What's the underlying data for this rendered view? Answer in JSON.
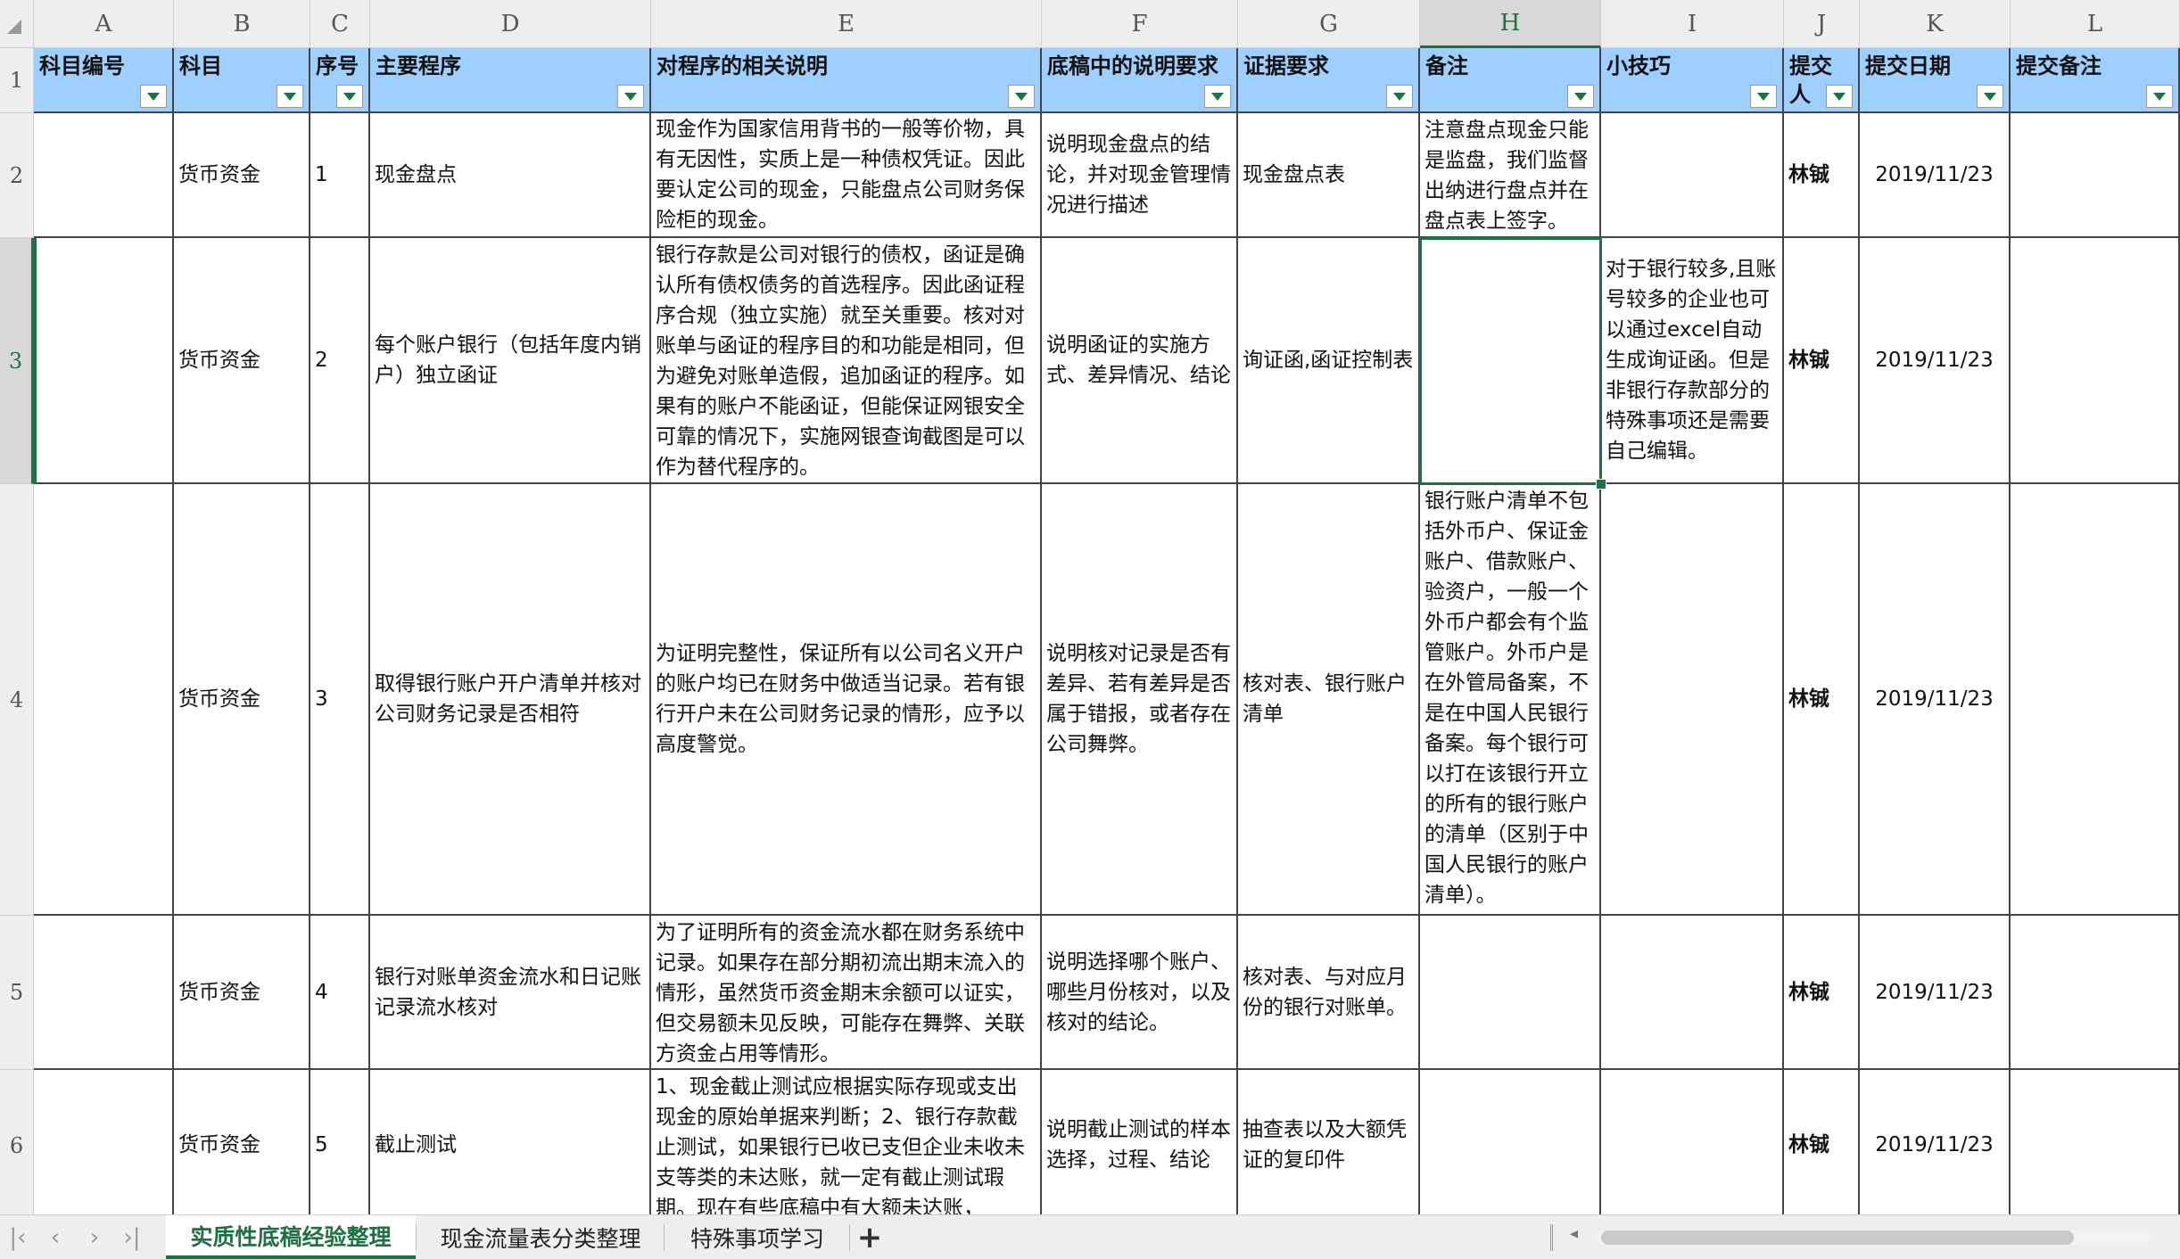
{
  "columns": [
    "A",
    "B",
    "C",
    "D",
    "E",
    "F",
    "G",
    "H",
    "I",
    "J",
    "K",
    "L"
  ],
  "selected_column": "H",
  "selected_row": "3",
  "header_row": {
    "number": "1",
    "cells": [
      "科目编号",
      "科目",
      "序号",
      "主要程序",
      "对程序的相关说明",
      "底稿中的说明要求",
      "证据要求",
      "备注",
      "小技巧",
      "提交人",
      "提交日期",
      "提交备注"
    ]
  },
  "rows": [
    {
      "number": "2",
      "cells": [
        "",
        "货币资金",
        "1",
        " 现金盘点",
        "现金作为国家信用背书的一般等价物，具有无因性，实质上是一种债权凭证。因此要认定公司的现金，只能盘点公司财务保险柜的现金。",
        "说明现金盘点的结论，并对现金管理情况进行描述",
        "现金盘点表",
        "注意盘点现金只能是监盘，我们监督出纳进行盘点并在盘点表上签字。",
        "",
        "林铖",
        "2019/11/23",
        ""
      ]
    },
    {
      "number": "3",
      "cells": [
        "",
        "货币资金",
        "2",
        "每个账户银行（包括年度内销户）独立函证",
        "银行存款是公司对银行的债权，函证是确认所有债权债务的首选程序。因此函证程序合规（独立实施）就至关重要。核对对账单与函证的程序目的和功能是相同，但为避免对账单造假，追加函证的程序。如果有的账户不能函证，但能保证网银安全可靠的情况下，实施网银查询截图是可以作为替代程序的。",
        "说明函证的实施方式、差异情况、结论",
        "询证函,函证控制表",
        "",
        "对于银行较多,且账号较多的企业也可以通过excel自动生成询证函。但是非银行存款部分的特殊事项还是需要自己编辑。",
        "林铖",
        "2019/11/23",
        ""
      ]
    },
    {
      "number": "4",
      "cells": [
        "",
        "货币资金",
        "3",
        "取得银行账户开户清单并核对公司财务记录是否相符",
        "为证明完整性，保证所有以公司名义开户的账户均已在财务中做适当记录。若有银行开户未在公司财务记录的情形，应予以高度警觉。",
        "说明核对记录是否有差异、若有差异是否属于错报，或者存在公司舞弊。",
        "核对表、银行账户清单",
        "银行账户清单不包括外币户、保证金账户、借款账户、验资户，一般一个外币户都会有个监管账户。外币户是在外管局备案，不是在中国人民银行备案。每个银行可以打在该银行开立的所有的银行账户的清单（区别于中国人民银行的账户清单）。",
        "",
        "林铖",
        "2019/11/23",
        ""
      ]
    },
    {
      "number": "5",
      "cells": [
        "",
        "货币资金",
        "4",
        "银行对账单资金流水和日记账记录流水核对",
        "为了证明所有的资金流水都在财务系统中记录。如果存在部分期初流出期末流入的情形，虽然货币资金期末余额可以证实，但交易额未见反映，可能存在舞弊、关联方资金占用等情形。",
        "说明选择哪个账户、哪些月份核对，以及核对的结论。",
        "核对表、与对应月份的银行对账单。",
        "",
        "",
        "林铖",
        "2019/11/23",
        ""
      ]
    },
    {
      "number": "6",
      "cells": [
        "",
        "货币资金",
        "5",
        "截止测试",
        "1、现金截止测试应根据实际存现或支出现金的原始单据来判断；2、银行存款截止测试，如果银行已收已支但企业未收未支等类的未达账，就一定有截止测试瑕期。现在有些底稿中有大额未达账，",
        "说明截止测试的样本选择，过程、结论",
        "抽查表以及大额凭证的复印件",
        "",
        "",
        "林铖",
        "2019/11/23",
        ""
      ]
    }
  ],
  "tabs": [
    {
      "label": "实质性底稿经验整理",
      "active": true
    },
    {
      "label": "现金流量表分类整理",
      "active": false
    },
    {
      "label": "特殊事项学习",
      "active": false
    }
  ],
  "tab_nav": {
    "first": "|‹",
    "prev": "‹",
    "next": "›",
    "last": "›|",
    "add": "+"
  }
}
